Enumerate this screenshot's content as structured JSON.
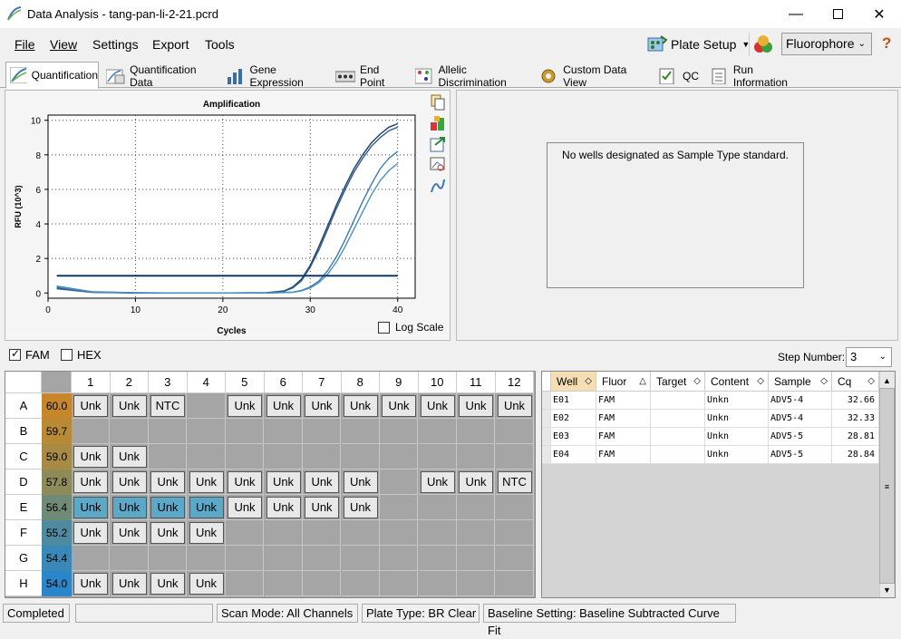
{
  "window": {
    "title": "Data Analysis - tang-pan-li-2-21.pcrd"
  },
  "menu": [
    "File",
    "View",
    "Settings",
    "Export",
    "Tools"
  ],
  "toolbar": {
    "plate_setup": "Plate Setup",
    "fluorophore": "Fluorophore"
  },
  "tabs": [
    "Quantification",
    "Quantification Data",
    "Gene Expression",
    "End Point",
    "Allelic Discrimination",
    "Custom Data View",
    "QC",
    "Run Information"
  ],
  "chart": {
    "title": "Amplification",
    "xlabel": "Cycles",
    "ylabel": "RFU (10^3)",
    "log_scale_label": "Log Scale"
  },
  "chart_data": {
    "type": "line",
    "title": "Amplification",
    "xlabel": "Cycles",
    "ylabel": "RFU (10^3)",
    "xlim": [
      0,
      42
    ],
    "ylim": [
      -0.3,
      10.3
    ],
    "xticks": [
      0,
      10,
      20,
      30,
      40
    ],
    "yticks": [
      0,
      2,
      4,
      6,
      8,
      10
    ],
    "grid": true,
    "threshold": 1.0,
    "series": [
      {
        "color": "#1c3e6e",
        "x": [
          1,
          5,
          10,
          15,
          20,
          25,
          27,
          28,
          29,
          30,
          31,
          32,
          33,
          34,
          35,
          36,
          37,
          38,
          39,
          40
        ],
        "y": [
          0.3,
          0.05,
          0,
          0,
          0,
          0.02,
          0.12,
          0.35,
          0.8,
          1.6,
          2.7,
          3.9,
          5.1,
          6.2,
          7.2,
          8.0,
          8.7,
          9.2,
          9.6,
          9.8
        ]
      },
      {
        "color": "#2d5f8a",
        "x": [
          1,
          5,
          10,
          15,
          20,
          25,
          27,
          28,
          29,
          30,
          31,
          32,
          33,
          34,
          35,
          36,
          37,
          38,
          39,
          40
        ],
        "y": [
          0.25,
          0.04,
          0,
          0,
          0,
          0.02,
          0.1,
          0.3,
          0.7,
          1.5,
          2.5,
          3.7,
          4.9,
          6.0,
          7.0,
          7.8,
          8.5,
          9.0,
          9.4,
          9.6
        ]
      },
      {
        "color": "#3a7ab0",
        "x": [
          1,
          5,
          10,
          15,
          20,
          25,
          28,
          29,
          30,
          31,
          32,
          33,
          34,
          35,
          36,
          37,
          38,
          39,
          40
        ],
        "y": [
          0.4,
          0.08,
          0.02,
          0,
          0,
          0,
          0.05,
          0.15,
          0.35,
          0.7,
          1.3,
          2.1,
          3.1,
          4.2,
          5.3,
          6.3,
          7.2,
          7.8,
          8.2
        ]
      },
      {
        "color": "#4a8fc2",
        "x": [
          1,
          5,
          10,
          15,
          20,
          25,
          28,
          29,
          30,
          31,
          32,
          33,
          34,
          35,
          36,
          37,
          38,
          39,
          40
        ],
        "y": [
          0.35,
          0.06,
          0.02,
          0,
          0,
          0,
          0.04,
          0.12,
          0.3,
          0.6,
          1.1,
          1.8,
          2.7,
          3.7,
          4.7,
          5.7,
          6.5,
          7.1,
          7.5
        ]
      }
    ]
  },
  "standard_panel": {
    "message": "No wells designated as Sample Type standard."
  },
  "filters": {
    "fam": "FAM",
    "hex": "HEX",
    "step_label": "Step Number:",
    "step_value": "3"
  },
  "plate": {
    "columns": [
      "1",
      "2",
      "3",
      "4",
      "5",
      "6",
      "7",
      "8",
      "9",
      "10",
      "11",
      "12"
    ],
    "rows": [
      {
        "label": "A",
        "temp": "60.0",
        "color": "#c8862a",
        "wells": [
          "Unk",
          "Unk",
          "NTC",
          "",
          "Unk",
          "Unk",
          "Unk",
          "Unk",
          "Unk",
          "Unk",
          "Unk",
          "Unk"
        ]
      },
      {
        "label": "B",
        "temp": "59.7",
        "color": "#b98a36",
        "wells": [
          "",
          "",
          "",
          "",
          "",
          "",
          "",
          "",
          "",
          "",
          "",
          ""
        ]
      },
      {
        "label": "C",
        "temp": "59.0",
        "color": "#a88a45",
        "wells": [
          "Unk",
          "Unk",
          "",
          "",
          "",
          "",
          "",
          "",
          "",
          "",
          "",
          ""
        ]
      },
      {
        "label": "D",
        "temp": "57.8",
        "color": "#8e8a5a",
        "wells": [
          "Unk",
          "Unk",
          "Unk",
          "Unk",
          "Unk",
          "Unk",
          "Unk",
          "Unk",
          "",
          "Unk",
          "Unk",
          "NTC"
        ]
      },
      {
        "label": "E",
        "temp": "56.4",
        "color": "#6f8a76",
        "wells": [
          "Unk",
          "Unk",
          "Unk",
          "Unk",
          "Unk",
          "Unk",
          "Unk",
          "Unk",
          "",
          "",
          "",
          ""
        ]
      },
      {
        "label": "F",
        "temp": "55.2",
        "color": "#4f8aa0",
        "wells": [
          "Unk",
          "Unk",
          "Unk",
          "Unk",
          "",
          "",
          "",
          "",
          "",
          "",
          "",
          ""
        ]
      },
      {
        "label": "G",
        "temp": "54.4",
        "color": "#3a88b8",
        "wells": [
          "",
          "",
          "",
          "",
          "",
          "",
          "",
          "",
          "",
          "",
          "",
          ""
        ]
      },
      {
        "label": "H",
        "temp": "54.0",
        "color": "#2a86c8",
        "wells": [
          "Unk",
          "Unk",
          "Unk",
          "Unk",
          "",
          "",
          "",
          "",
          "",
          "",
          "",
          ""
        ]
      }
    ],
    "selected": [
      "E1",
      "E2",
      "E3",
      "E4"
    ]
  },
  "table": {
    "headers": [
      "Well",
      "Fluor",
      "Target",
      "Content",
      "Sample",
      "Cq"
    ],
    "rows": [
      [
        "E01",
        "FAM",
        "",
        "Unkn",
        "ADV5-4",
        "32.66"
      ],
      [
        "E02",
        "FAM",
        "",
        "Unkn",
        "ADV5-4",
        "32.33"
      ],
      [
        "E03",
        "FAM",
        "",
        "Unkn",
        "ADV5-5",
        "28.81"
      ],
      [
        "E04",
        "FAM",
        "",
        "Unkn",
        "ADV5-5",
        "28.84"
      ]
    ]
  },
  "status": {
    "state": "Completed",
    "scan_mode": "Scan Mode: All Channels",
    "plate_type": "Plate Type: BR Clear",
    "baseline": "Baseline Setting: Baseline Subtracted Curve Fit"
  }
}
